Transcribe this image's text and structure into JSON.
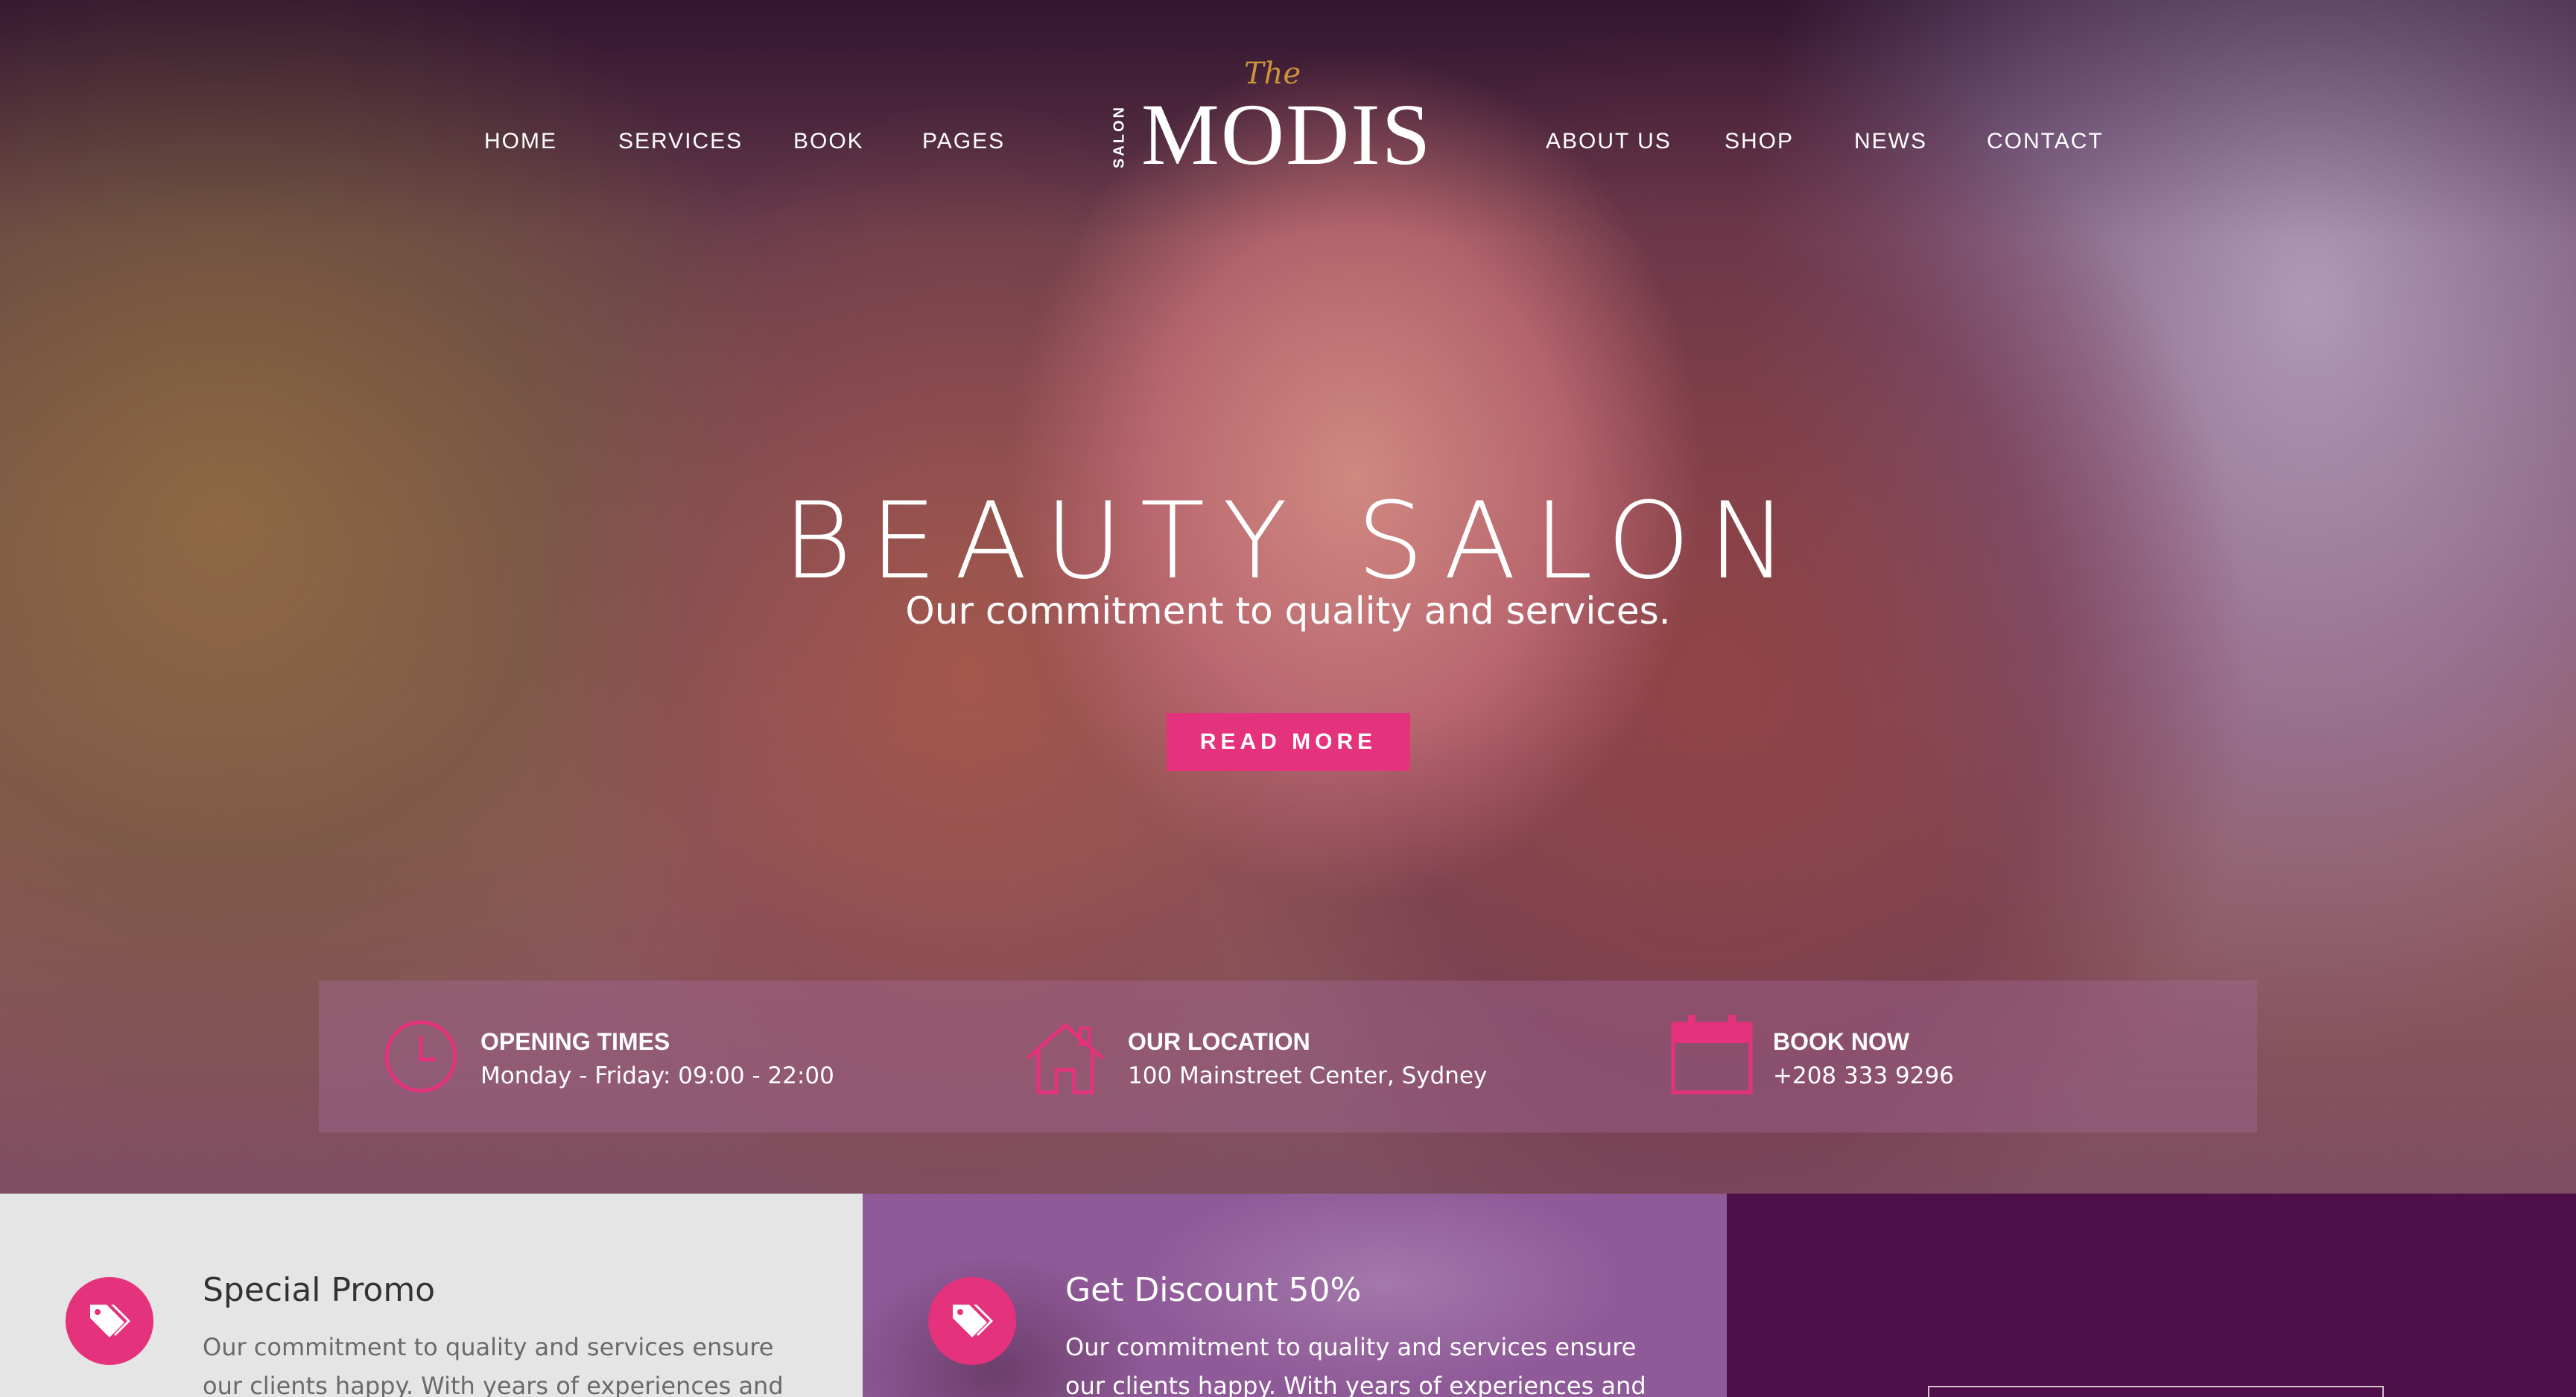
{
  "nav": {
    "left": [
      "HOME",
      "SERVICES",
      "BOOK",
      "PAGES"
    ],
    "right": [
      "ABOUT US",
      "SHOP",
      "NEWS",
      "CONTACT"
    ]
  },
  "logo": {
    "the": "The",
    "side": "SALON",
    "main": "MODIS"
  },
  "hero": {
    "title": "BEAUTY SALON",
    "subtitle": "Our commitment to quality and services.",
    "button_label": "READ MORE"
  },
  "info": [
    {
      "icon": "clock-icon",
      "heading": "OPENING TIMES",
      "text": "Monday - Friday: 09:00 - 22:00"
    },
    {
      "icon": "house-icon",
      "heading": "OUR LOCATION",
      "text": "100 Mainstreet Center, Sydney"
    },
    {
      "icon": "calendar-icon",
      "heading": "BOOK NOW",
      "text": "+208 333 9296"
    }
  ],
  "panels": [
    {
      "icon": "tag-icon",
      "title": "Special Promo",
      "text": "Our commitment to quality and services ensure our clients happy. With years of experiences and"
    },
    {
      "icon": "tag-icon",
      "title": "Get Discount 50%",
      "text": "Our commitment to quality and services ensure our clients happy. With years of experiences and"
    }
  ],
  "colors": {
    "accent": "#e5327c",
    "panel_light": "#e5e5e5",
    "panel_mid": "#8f5a98",
    "panel_dark": "#4e0f4a",
    "logo_gold": "#c9943c"
  }
}
